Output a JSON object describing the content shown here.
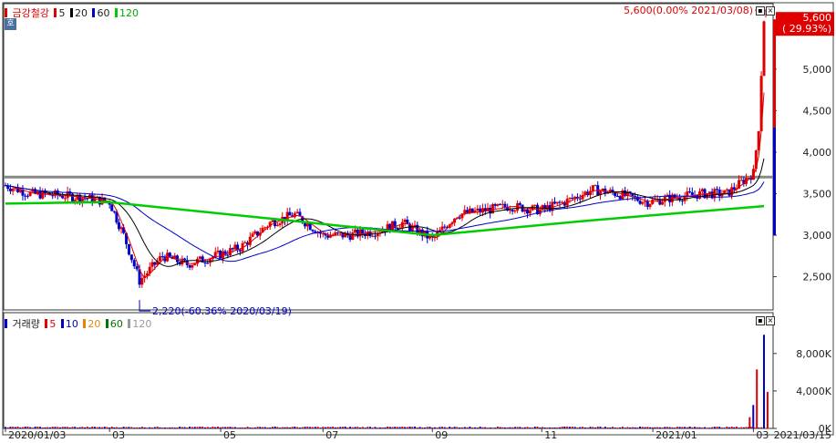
{
  "price_panel": {
    "stock_name": "금강철강",
    "ma_legend": [
      {
        "label": "5",
        "color": "#e00000"
      },
      {
        "label": "20",
        "color": "#000000"
      },
      {
        "label": "60",
        "color": "#0000cc"
      },
      {
        "label": "120",
        "color": "#00cc00"
      }
    ],
    "hoga_icon": "호",
    "max_annotation": "5,600(0.00% 2021/03/08)",
    "min_annotation": "2,220(-60.36% 2020/03/19)",
    "current_price_label": "5,600",
    "current_change_label": "( 29.93%)",
    "y_ticks": [
      "5,000",
      "4,500",
      "4,000",
      "3,500",
      "3,000",
      "2,500"
    ]
  },
  "volume_panel": {
    "title": "거래량",
    "ma_legend": [
      {
        "label": "5",
        "color": "#e00000"
      },
      {
        "label": "10",
        "color": "#0000cc"
      },
      {
        "label": "20",
        "color": "#e08800"
      },
      {
        "label": "60",
        "color": "#007700"
      },
      {
        "label": "120",
        "color": "#999999"
      }
    ],
    "y_ticks": [
      "8,000K",
      "4,000K",
      "0K"
    ]
  },
  "x_axis": {
    "ticks": [
      "2020/01/03",
      "03",
      "05",
      "07",
      "09",
      "11",
      "2021/01",
      "03"
    ],
    "end_label": "2021/03/15"
  },
  "colors": {
    "up": "#e00000",
    "down": "#0000cc",
    "ma5": "#e00000",
    "ma20": "#000000",
    "ma60": "#0000cc",
    "ma120": "#00cc00",
    "hline": "#888888"
  },
  "chart_data": {
    "type": "candlestick",
    "title": "금강철강",
    "x_range": [
      "2020/01/03",
      "2021/03/15"
    ],
    "price_ylim": [
      2100,
      5800
    ],
    "volume_ylim": [
      0,
      11000
    ],
    "volume_unit": "K",
    "horizontal_line": 3700,
    "max_point": {
      "date": "2021/03/08",
      "value": 5600
    },
    "min_point": {
      "date": "2020/03/19",
      "value": 2220
    },
    "close_series": [
      {
        "date": "2020-01-03",
        "close": 3600
      },
      {
        "date": "2020-01-17",
        "close": 3500
      },
      {
        "date": "2020-02-03",
        "close": 3480
      },
      {
        "date": "2020-02-17",
        "close": 3450
      },
      {
        "date": "2020-03-02",
        "close": 3400
      },
      {
        "date": "2020-03-10",
        "close": 3000
      },
      {
        "date": "2020-03-19",
        "close": 2450
      },
      {
        "date": "2020-04-01",
        "close": 2750
      },
      {
        "date": "2020-04-15",
        "close": 2650
      },
      {
        "date": "2020-05-01",
        "close": 2750
      },
      {
        "date": "2020-05-15",
        "close": 2850
      },
      {
        "date": "2020-06-01",
        "close": 3150
      },
      {
        "date": "2020-06-15",
        "close": 3250
      },
      {
        "date": "2020-07-01",
        "close": 3000
      },
      {
        "date": "2020-07-15",
        "close": 3000
      },
      {
        "date": "2020-08-01",
        "close": 3050
      },
      {
        "date": "2020-08-15",
        "close": 3150
      },
      {
        "date": "2020-09-01",
        "close": 2950
      },
      {
        "date": "2020-09-15",
        "close": 3250
      },
      {
        "date": "2020-10-01",
        "close": 3300
      },
      {
        "date": "2020-10-15",
        "close": 3350
      },
      {
        "date": "2020-11-01",
        "close": 3300
      },
      {
        "date": "2020-11-15",
        "close": 3400
      },
      {
        "date": "2020-12-01",
        "close": 3550
      },
      {
        "date": "2020-12-15",
        "close": 3500
      },
      {
        "date": "2021-01-01",
        "close": 3400
      },
      {
        "date": "2021-01-15",
        "close": 3450
      },
      {
        "date": "2021-02-01",
        "close": 3500
      },
      {
        "date": "2021-02-15",
        "close": 3500
      },
      {
        "date": "2021-03-02",
        "close": 3750
      },
      {
        "date": "2021-03-05",
        "close": 4300
      },
      {
        "date": "2021-03-08",
        "close": 5600
      }
    ],
    "ma120": [
      {
        "date": "2020-01-03",
        "value": 3380
      },
      {
        "date": "2020-03-01",
        "value": 3400
      },
      {
        "date": "2020-06-01",
        "value": 3200
      },
      {
        "date": "2020-09-01",
        "value": 3000
      },
      {
        "date": "2020-12-01",
        "value": 3180
      },
      {
        "date": "2021-03-08",
        "value": 3350
      }
    ],
    "volume_series": [
      {
        "date": "2021-03-03",
        "volume": 1200
      },
      {
        "date": "2021-03-04",
        "volume": 2500
      },
      {
        "date": "2021-03-05",
        "volume": 6300
      },
      {
        "date": "2021-03-08",
        "volume": 10000
      },
      {
        "date": "2021-03-09",
        "volume": 3900
      }
    ]
  }
}
